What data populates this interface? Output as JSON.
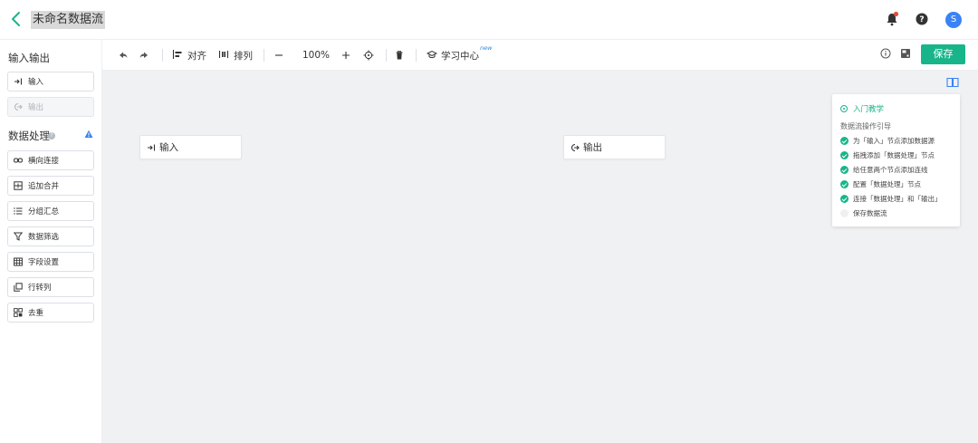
{
  "header": {
    "title": "未命名数据流",
    "avatar_letter": "S"
  },
  "sidebar": {
    "io_title": "输入输出",
    "io_items": [
      {
        "label": "输入",
        "icon": "input-icon",
        "enabled": true
      },
      {
        "label": "输出",
        "icon": "output-icon",
        "enabled": false
      }
    ],
    "proc_title": "数据处理",
    "proc_items": [
      {
        "label": "横向连接",
        "icon": "link-icon"
      },
      {
        "label": "追加合并",
        "icon": "append-icon"
      },
      {
        "label": "分组汇总",
        "icon": "list-icon"
      },
      {
        "label": "数据筛选",
        "icon": "filter-icon"
      },
      {
        "label": "字段设置",
        "icon": "table-icon"
      },
      {
        "label": "行转列",
        "icon": "pivot-icon"
      },
      {
        "label": "去重",
        "icon": "dedupe-icon"
      }
    ]
  },
  "toolbar": {
    "align_label": "对齐",
    "arrange_label": "排列",
    "zoom": "100%",
    "learn_label": "学习中心",
    "new_badge": "new",
    "save_label": "保存"
  },
  "canvas": {
    "nodes": [
      {
        "label": "输入",
        "icon": "input-icon"
      },
      {
        "label": "输出",
        "icon": "output-icon"
      }
    ]
  },
  "guide": {
    "title": "入门教学",
    "subtitle": "数据流操作引导",
    "steps": [
      {
        "label": "为「输入」节点添加数据源",
        "done": true
      },
      {
        "label": "拖拽添加「数据处理」节点",
        "done": true
      },
      {
        "label": "给任意两个节点添加连线",
        "done": true
      },
      {
        "label": "配置「数据处理」节点",
        "done": true
      },
      {
        "label": "连接「数据处理」和「输出」",
        "done": true
      },
      {
        "label": "保存数据流",
        "done": false
      }
    ]
  },
  "colors": {
    "accent": "#19b58a",
    "avatar": "#3b82f6",
    "canvas_bg": "#f0f1f3"
  }
}
